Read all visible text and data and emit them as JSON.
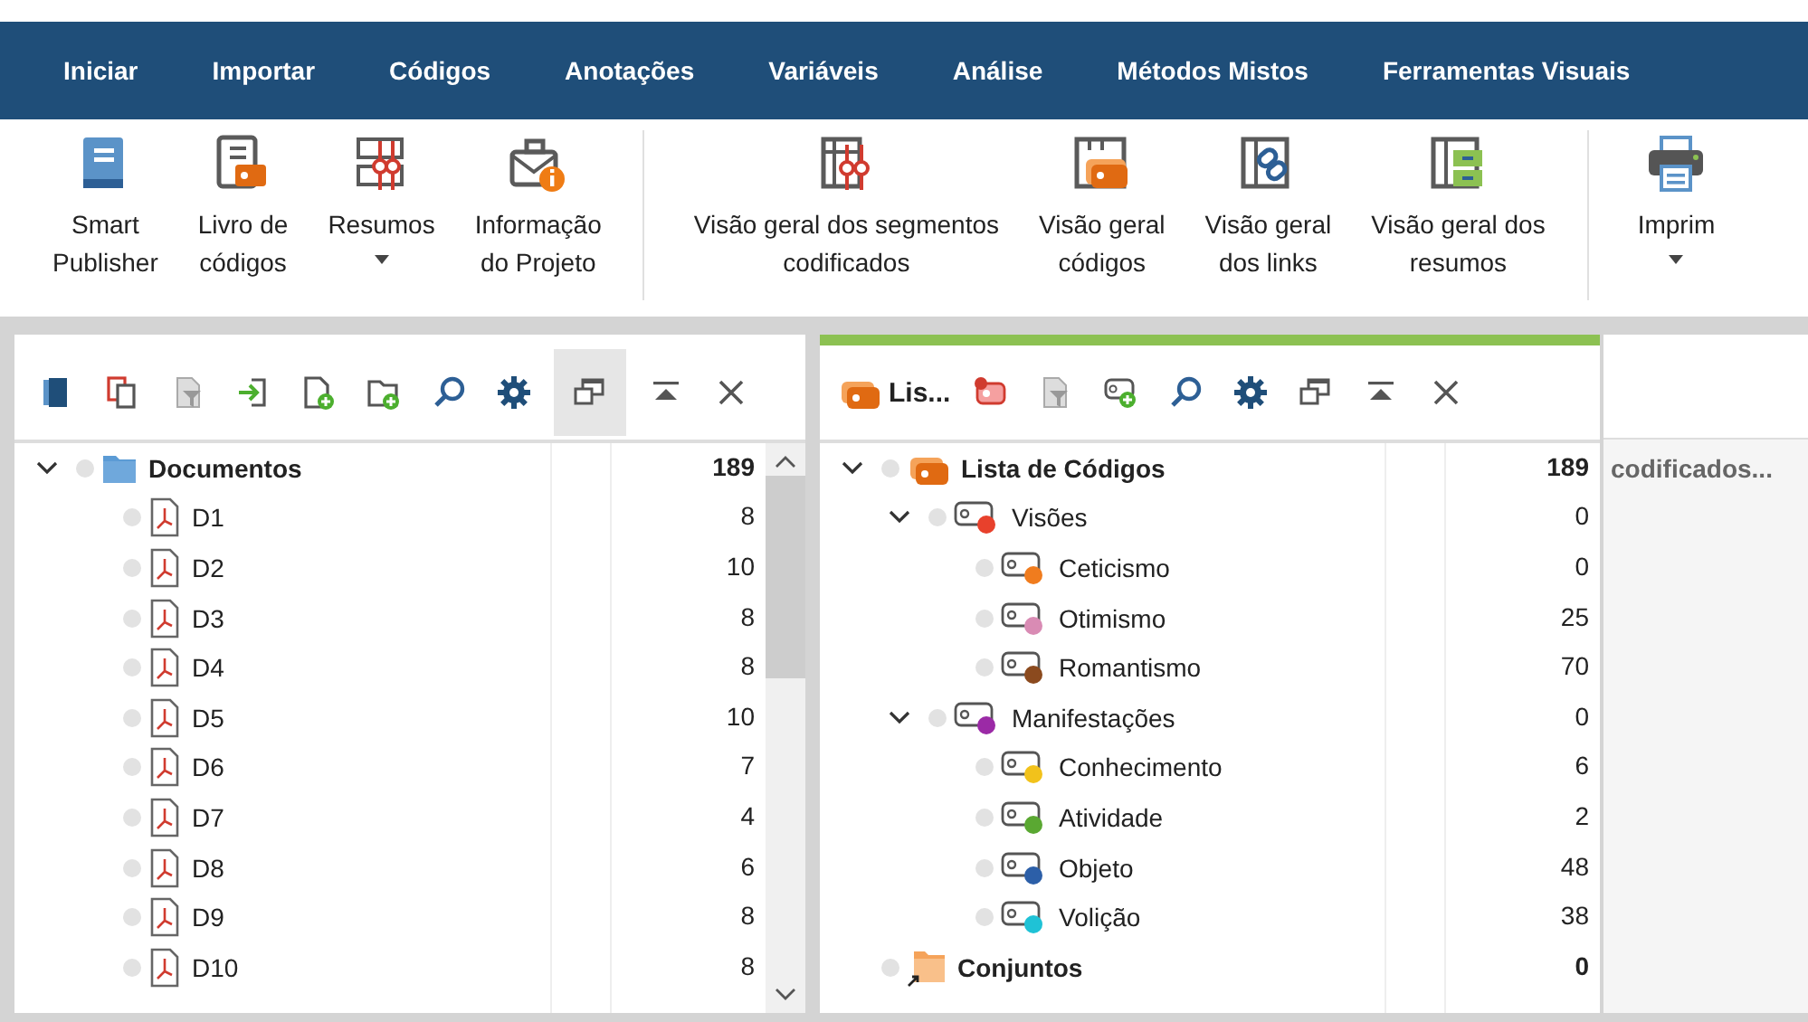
{
  "menu": [
    {
      "label": "Iniciar",
      "selected": false
    },
    {
      "label": "Importar",
      "selected": false
    },
    {
      "label": "Códigos",
      "selected": false
    },
    {
      "label": "Anotações",
      "selected": false
    },
    {
      "label": "Variáveis",
      "selected": false
    },
    {
      "label": "Análise",
      "selected": false
    },
    {
      "label": "Métodos Mistos",
      "selected": false
    },
    {
      "label": "Ferramentas Visuais",
      "selected": false
    }
  ],
  "ribbon": [
    {
      "buttons": [
        {
          "label": "Smart\nPublisher",
          "dropdown": false
        },
        {
          "label": "Livro de\ncódigos",
          "dropdown": false
        },
        {
          "label": "Resumos",
          "dropdown": true
        },
        {
          "label": "Informação\ndo Projeto",
          "dropdown": false
        }
      ]
    },
    {
      "buttons": [
        {
          "label": "Visão geral dos segmentos\ncodificados",
          "dropdown": false
        },
        {
          "label": "Visão geral\ncódigos",
          "dropdown": false
        },
        {
          "label": "Visão geral\ndos links",
          "dropdown": false
        },
        {
          "label": "Visão geral dos\nresumos",
          "dropdown": false
        }
      ]
    },
    {
      "buttons": [
        {
          "label": "Imprim",
          "dropdown": true
        }
      ]
    }
  ],
  "panels": [
    {
      "focused": false,
      "toolbar": [
        {
          "active": false
        },
        {
          "active": false
        },
        {
          "active": false
        },
        {
          "active": false
        },
        {
          "active": false
        },
        {
          "active": false
        },
        {
          "active": false
        },
        {
          "active": false
        },
        {
          "active": true
        },
        {
          "active": false
        },
        {
          "active": false
        }
      ],
      "tree": [
        {
          "kind": "folder",
          "label": "Documentos",
          "count": "189",
          "expanded": true,
          "children": [
            {
              "kind": "pdf",
              "label": "D1",
              "count": "8"
            },
            {
              "kind": "pdf",
              "label": "D2",
              "count": "10"
            },
            {
              "kind": "pdf",
              "label": "D3",
              "count": "8"
            },
            {
              "kind": "pdf",
              "label": "D4",
              "count": "8"
            },
            {
              "kind": "pdf",
              "label": "D5",
              "count": "10"
            },
            {
              "kind": "pdf",
              "label": "D6",
              "count": "7"
            },
            {
              "kind": "pdf",
              "label": "D7",
              "count": "4"
            },
            {
              "kind": "pdf",
              "label": "D8",
              "count": "6"
            },
            {
              "kind": "pdf",
              "label": "D9",
              "count": "8"
            },
            {
              "kind": "pdf",
              "label": "D10",
              "count": "8"
            }
          ]
        }
      ]
    },
    {
      "focused": true,
      "title": "Lis...",
      "toolbar": [
        {
          "active": false
        },
        {
          "active": false
        },
        {
          "active": false
        },
        {
          "active": false
        },
        {
          "active": false
        },
        {
          "active": false
        },
        {
          "active": false
        },
        {
          "active": false
        }
      ],
      "tree": [
        {
          "kind": "codesystem",
          "label": "Lista de Códigos",
          "count": "189",
          "expanded": true,
          "children": [
            {
              "kind": "code",
              "label": "Visões",
              "count": "0",
              "color": "#e8412c",
              "expanded": true,
              "children": [
                {
                  "kind": "code",
                  "label": "Ceticismo",
                  "count": "0",
                  "color": "#f07c1e"
                },
                {
                  "kind": "code",
                  "label": "Otimismo",
                  "count": "25",
                  "color": "#d98bb4"
                },
                {
                  "kind": "code",
                  "label": "Romantismo",
                  "count": "70",
                  "color": "#8b4a1e"
                }
              ]
            },
            {
              "kind": "code",
              "label": "Manifestações",
              "count": "0",
              "color": "#9b2aa6",
              "expanded": true,
              "children": [
                {
                  "kind": "code",
                  "label": "Conhecimento",
                  "count": "6",
                  "color": "#f2c21b"
                },
                {
                  "kind": "code",
                  "label": "Atividade",
                  "count": "2",
                  "color": "#5aa832"
                },
                {
                  "kind": "code",
                  "label": "Objeto",
                  "count": "48",
                  "color": "#2c5fa8"
                },
                {
                  "kind": "code",
                  "label": "Volição",
                  "count": "38",
                  "color": "#1fc2d6"
                }
              ]
            }
          ]
        },
        {
          "kind": "sets",
          "label": "Conjuntos",
          "count": "0"
        }
      ]
    }
  ],
  "side": {
    "text": "codificados..."
  }
}
